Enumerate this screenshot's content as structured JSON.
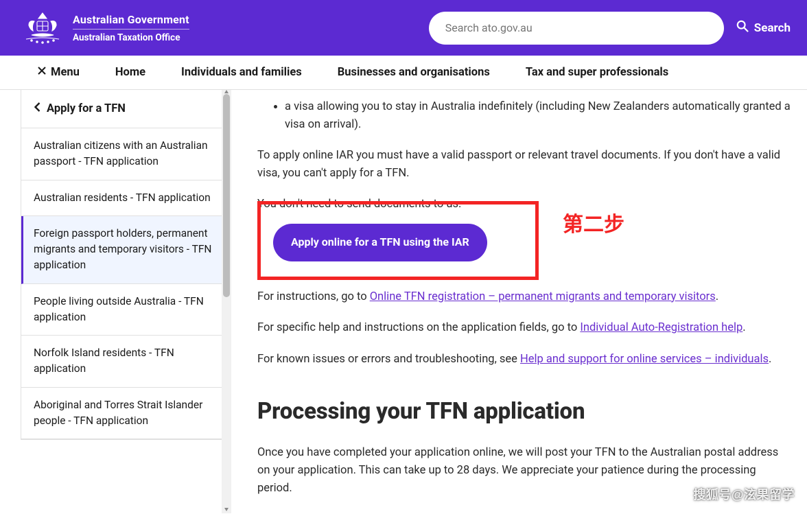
{
  "header": {
    "gov": "Australian Government",
    "ato": "Australian Taxation Office",
    "search_placeholder": "Search ato.gov.au",
    "search_btn": "Search"
  },
  "nav": {
    "menu": "Menu",
    "items": [
      "Home",
      "Individuals and families",
      "Businesses and organisations",
      "Tax and super professionals"
    ]
  },
  "sidebar": {
    "title": "Apply for a TFN",
    "items": [
      "Australian citizens with an Australian passport - TFN application",
      "Australian residents - TFN application",
      "Foreign passport holders, permanent migrants and temporary visitors - TFN application",
      "People living outside Australia - TFN application",
      "Norfolk Island residents - TFN application",
      "Aboriginal and Torres Strait Islander people - TFN application"
    ],
    "active_index": 2
  },
  "content": {
    "bullet": "a visa allowing you to stay in Australia indefinitely (including New Zealanders automatically granted a visa on arrival).",
    "para_apply": "To apply online IAR you must have a valid passport or relevant travel documents. If you don't have a valid visa, you can't apply for a TFN.",
    "para_nodocs": "You don't need to send documents to us.",
    "cta": "Apply online for a TFN using the IAR",
    "step_label": "第二步",
    "instr_prefix": "For instructions, go to ",
    "instr_link": "Online TFN registration – permanent migrants and temporary visitors",
    "instr_suffix": ".",
    "help_prefix": "For specific help and instructions on the application fields, go to ",
    "help_link": "Individual Auto-Registration help",
    "help_suffix": ".",
    "issues_prefix": "For known issues or errors and troubleshooting, see ",
    "issues_link": "Help and support for online services – individuals",
    "issues_suffix": ".",
    "h2": "Processing your TFN application",
    "processing": "Once you have completed your application online, we will post your TFN to the Australian postal address on your application. This can take up to 28 days. We appreciate your patience during the processing period."
  },
  "watermark": "搜狐号@泫果留学"
}
